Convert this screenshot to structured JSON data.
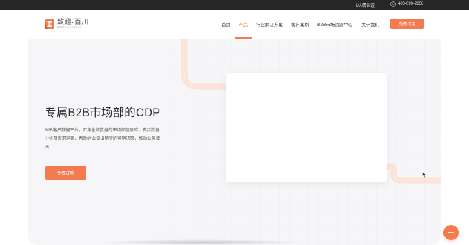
{
  "topbar": {
    "cert_label": "MA情认证",
    "phone": "400-099-2858",
    "phone_icon": "phone-icon"
  },
  "header": {
    "logo_name": "致趣·百川",
    "logo_sub": "BESTCHANNELS",
    "logo_icon": "brand-logo-icon",
    "nav": [
      {
        "label": "首页",
        "active": false
      },
      {
        "label": "产品",
        "active": true
      },
      {
        "label": "行业解决方案",
        "active": false
      },
      {
        "label": "客户案例",
        "active": false
      },
      {
        "label": "B2B市场资源中心",
        "active": false
      },
      {
        "label": "关于我们",
        "active": false
      }
    ],
    "cta_label": "免费试用"
  },
  "hero": {
    "title": "专属B2B市场部的CDP",
    "description": "B2B客户数据平台，汇集全域数据的市场部信息库，支持数据分析及需求洞察，帮助企业做出明智的营销决策，推动业务增长",
    "cta_label": "免费试用"
  },
  "colors": {
    "accent": "#f47b4f",
    "topbar_bg": "#262626",
    "hero_bg": "#f6f6f8",
    "road_pink": "#f9d9cf"
  },
  "chat": {
    "icon": "chat-bubble-icon"
  }
}
